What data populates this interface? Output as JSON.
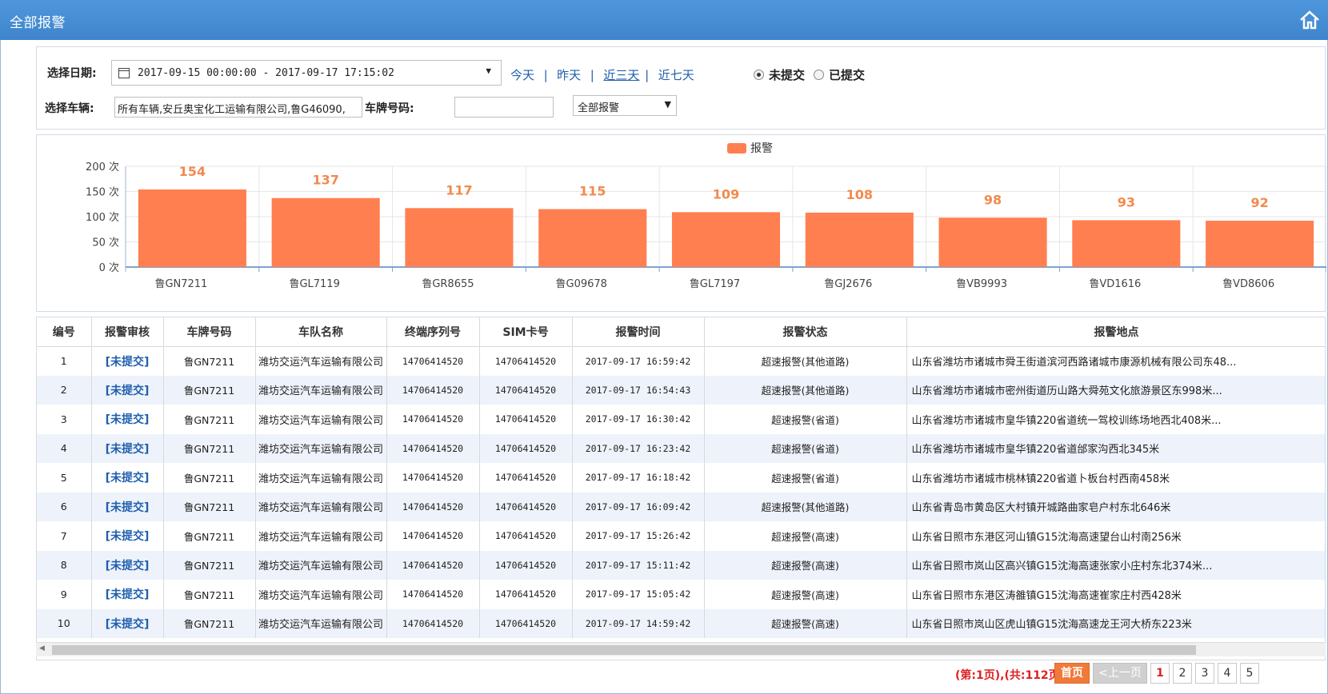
{
  "titlebar": {
    "title": "全部报警",
    "home_icon": "home-icon"
  },
  "filter": {
    "date_label": "选择日期:",
    "date_range": "2017-09-15 00:00:00 - 2017-09-17 17:15:02",
    "quick": [
      "今天",
      "昨天",
      "近三天",
      "近七天"
    ],
    "quick_active": "近三天",
    "radio_unsubmitted": "未提交",
    "radio_submitted": "已提交",
    "vehicle_label": "选择车辆:",
    "vehicle_value": "所有车辆,安丘奥宝化工运输有限公司,鲁G46090,",
    "plate_label": "车牌号码:",
    "plate_value": "",
    "alarm_type": "全部报警"
  },
  "chart_data": {
    "type": "bar",
    "categories": [
      "鲁GN7211",
      "鲁GL7119",
      "鲁GR8655",
      "鲁G09678",
      "鲁GL7197",
      "鲁GJ2676",
      "鲁VB9993",
      "鲁VD1616",
      "鲁VD8606"
    ],
    "series": [
      {
        "name": "报警",
        "values": [
          154,
          137,
          117,
          115,
          109,
          108,
          98,
          93,
          92
        ],
        "color": "#ff7f50"
      }
    ],
    "yticks": [
      "200 次",
      "150 次",
      "100 次",
      "50 次",
      "0 次"
    ],
    "ylim": [
      0,
      200
    ],
    "legend": "top-center",
    "grid": true
  },
  "table": {
    "headers": [
      "编号",
      "报警审核",
      "车牌号码",
      "车队名称",
      "终端序列号",
      "SIM卡号",
      "报警时间",
      "报警状态",
      "报警地点"
    ],
    "rows": [
      [
        "1",
        "[未提交]",
        "鲁GN7211",
        "潍坊交运汽车运输有限公司",
        "14706414520",
        "14706414520",
        "2017-09-17 16:59:42",
        "超速报警(其他道路)",
        "山东省潍坊市诸城市舜王街道滨河西路诸城市康源机械有限公司东48..."
      ],
      [
        "2",
        "[未提交]",
        "鲁GN7211",
        "潍坊交运汽车运输有限公司",
        "14706414520",
        "14706414520",
        "2017-09-17 16:54:43",
        "超速报警(其他道路)",
        "山东省潍坊市诸城市密州街道历山路大舜苑文化旅游景区东998米..."
      ],
      [
        "3",
        "[未提交]",
        "鲁GN7211",
        "潍坊交运汽车运输有限公司",
        "14706414520",
        "14706414520",
        "2017-09-17 16:30:42",
        "超速报警(省道)",
        "山东省潍坊市诸城市皇华镇220省道统一驾校训练场地西北408米..."
      ],
      [
        "4",
        "[未提交]",
        "鲁GN7211",
        "潍坊交运汽车运输有限公司",
        "14706414520",
        "14706414520",
        "2017-09-17 16:23:42",
        "超速报警(省道)",
        "山东省潍坊市诸城市皇华镇220省道邰家沟西北345米"
      ],
      [
        "5",
        "[未提交]",
        "鲁GN7211",
        "潍坊交运汽车运输有限公司",
        "14706414520",
        "14706414520",
        "2017-09-17 16:18:42",
        "超速报警(省道)",
        "山东省潍坊市诸城市桃林镇220省道卜板台村西南458米"
      ],
      [
        "6",
        "[未提交]",
        "鲁GN7211",
        "潍坊交运汽车运输有限公司",
        "14706414520",
        "14706414520",
        "2017-09-17 16:09:42",
        "超速报警(其他道路)",
        "山东省青岛市黄岛区大村镇开城路曲家皂户村东北646米"
      ],
      [
        "7",
        "[未提交]",
        "鲁GN7211",
        "潍坊交运汽车运输有限公司",
        "14706414520",
        "14706414520",
        "2017-09-17 15:26:42",
        "超速报警(高速)",
        "山东省日照市东港区河山镇G15沈海高速望台山村南256米"
      ],
      [
        "8",
        "[未提交]",
        "鲁GN7211",
        "潍坊交运汽车运输有限公司",
        "14706414520",
        "14706414520",
        "2017-09-17 15:11:42",
        "超速报警(高速)",
        "山东省日照市岚山区高兴镇G15沈海高速张家小庄村东北374米..."
      ],
      [
        "9",
        "[未提交]",
        "鲁GN7211",
        "潍坊交运汽车运输有限公司",
        "14706414520",
        "14706414520",
        "2017-09-17 15:05:42",
        "超速报警(高速)",
        "山东省日照市东港区涛雒镇G15沈海高速崔家庄村西428米"
      ],
      [
        "10",
        "[未提交]",
        "鲁GN7211",
        "潍坊交运汽车运输有限公司",
        "14706414520",
        "14706414520",
        "2017-09-17 14:59:42",
        "超速报警(高速)",
        "山东省日照市岚山区虎山镇G15沈海高速龙王河大桥东223米"
      ]
    ]
  },
  "pager": {
    "info": "(第:1页),(共:112页)",
    "first": "首页",
    "prev": "<上一页",
    "pages": [
      "1",
      "2",
      "3",
      "4",
      "5"
    ],
    "current": "1"
  }
}
